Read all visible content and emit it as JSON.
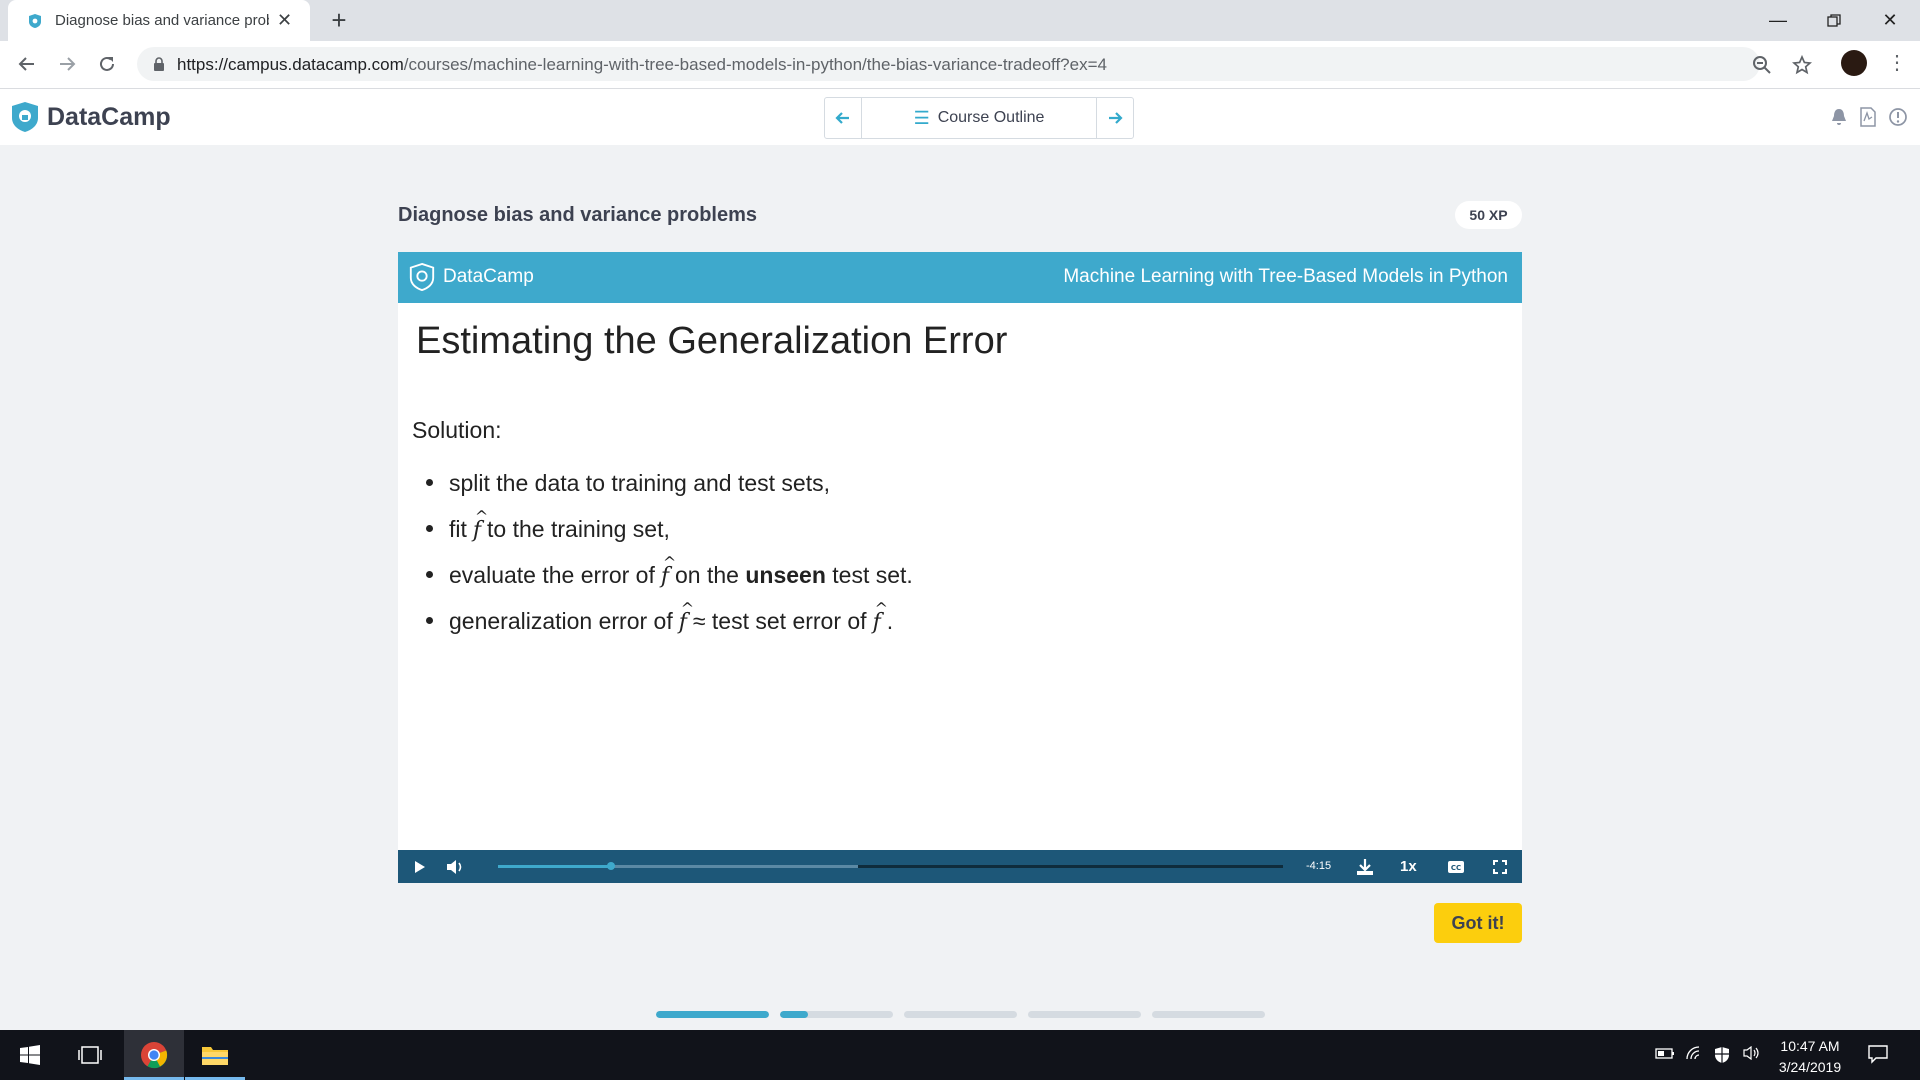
{
  "browser": {
    "tab_title": "Diagnose bias and variance prob",
    "url_host": "https://campus.datacamp.com",
    "url_path": "/courses/machine-learning-with-tree-based-models-in-python/the-bias-variance-tradeoff?ex=4"
  },
  "header": {
    "brand": "DataCamp",
    "outline_label": "Course Outline"
  },
  "exercise": {
    "title": "Diagnose bias and variance problems",
    "xp": "50 XP"
  },
  "slide": {
    "brand": "DataCamp",
    "course": "Machine Learning with Tree-Based Models in Python",
    "title": "Estimating the Generalization Error",
    "solution_label": "Solution:",
    "b1": "split the data to training and test sets,",
    "b2_a": "fit",
    "b2_b": "to the training set,",
    "b3_a": "evaluate the error of",
    "b3_b": "on the",
    "b3_bold": "unseen",
    "b3_c": "test set.",
    "b4_a": "generalization error of",
    "b4_approx": "≈",
    "b4_b": "test set error of",
    "b4_c": ".",
    "f_symbol": "f"
  },
  "player": {
    "time_remaining": "-4:15",
    "speed": "1x",
    "progress_fraction": 0.144,
    "buffered_fraction": 0.459
  },
  "actions": {
    "got_it": "Got it!"
  },
  "progress_segments": [
    {
      "fill": 1.0
    },
    {
      "fill": 0.25
    },
    {
      "fill": 0
    },
    {
      "fill": 0
    },
    {
      "fill": 0
    }
  ],
  "taskbar": {
    "time": "10:47 AM",
    "date": "3/24/2019"
  },
  "colors": {
    "accent": "#3ea9cc",
    "button": "#fcce0d",
    "player_bg": "#1d5778"
  }
}
